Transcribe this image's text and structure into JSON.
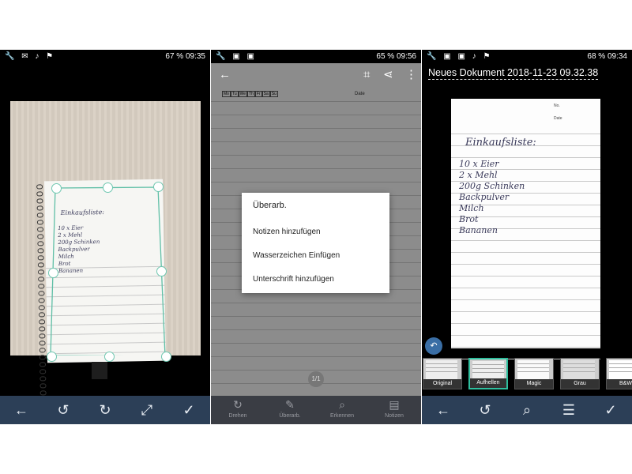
{
  "panels": [
    {
      "status": {
        "left_icons": "🔧 ✉ ♪ ⚑",
        "battery": "67 %",
        "time": "09:35"
      },
      "nav": [
        "←",
        "↺",
        "↻",
        "⤢",
        "✓"
      ]
    },
    {
      "status": {
        "left_icons": "🔧 ▣ ▣",
        "battery": "65 %",
        "time": "09:56"
      },
      "toolbar": {
        "back": "←",
        "crop": "⌗",
        "share": "⋖",
        "more": "⋮"
      },
      "days": [
        "Mo",
        "Tu",
        "We",
        "Th",
        "Fr",
        "Sa",
        "Su"
      ],
      "date_label": "Date",
      "dialog": {
        "title": "Überarb.",
        "items": [
          "Notizen hinzufügen",
          "Wasserzeichen Einfügen",
          "Unterschrift hinzufügen"
        ]
      },
      "page_indicator": "1/1",
      "nav": [
        {
          "icon": "↻",
          "label": "Drehen"
        },
        {
          "icon": "✎",
          "label": "Überarb."
        },
        {
          "icon": "⌕",
          "label": "Erkennen"
        },
        {
          "icon": "▤",
          "label": "Notizen"
        }
      ]
    },
    {
      "status": {
        "left_icons": "🔧 ▣ ▣ ♪ ⚑",
        "battery": "68 %",
        "time": "09:34"
      },
      "doc_title": "Neues Dokument 2018-11-23 09.32.38",
      "no_label": "No.",
      "date_label": "Date",
      "rotate_icon": "↶",
      "filters": [
        "Original",
        "Aufhellen",
        "Magic",
        "Grau",
        "B&W"
      ],
      "selected_filter": "Aufhellen",
      "nav": [
        "←",
        "↺",
        "⌕",
        "☰",
        "✓"
      ]
    }
  ],
  "note": {
    "title": "Einkaufsliste:",
    "items": [
      "10 x Eier",
      "2 x Mehl",
      "200g Schinken",
      "Backpulver",
      "Milch",
      "Brot",
      "Bananen"
    ]
  }
}
